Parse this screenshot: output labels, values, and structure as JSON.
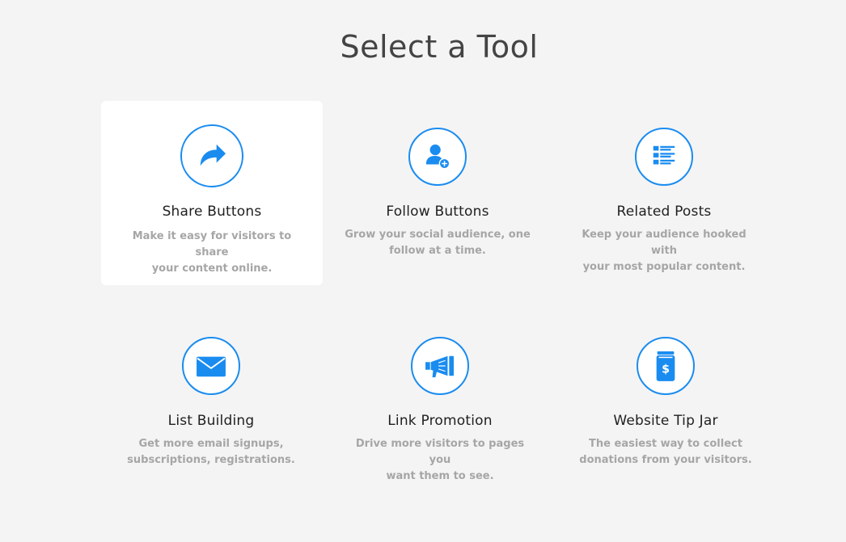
{
  "page": {
    "title": "Select a Tool"
  },
  "colors": {
    "accent": "#1a8cf0",
    "background": "#f4f4f4",
    "title_text": "#444444",
    "card_title_text": "#1f1f1f",
    "description_text": "#a6a6a6",
    "active_card": "#ffffff"
  },
  "tools": [
    {
      "icon": "share-arrow-icon",
      "title": "Share Buttons",
      "desc_line1": "Make it easy for visitors to share",
      "desc_line2": "your content online.",
      "selected": true
    },
    {
      "icon": "add-user-icon",
      "title": "Follow Buttons",
      "desc_line1": "Grow your social audience, one",
      "desc_line2": "follow at a time.",
      "selected": false
    },
    {
      "icon": "list-icon",
      "title": "Related Posts",
      "desc_line1": "Keep your audience hooked with",
      "desc_line2": "your most popular content.",
      "selected": false
    },
    {
      "icon": "envelope-icon",
      "title": "List Building",
      "desc_line1": "Get more email signups,",
      "desc_line2": "subscriptions, registrations.",
      "selected": false
    },
    {
      "icon": "megaphone-icon",
      "title": "Link Promotion",
      "desc_line1": "Drive more visitors to pages you",
      "desc_line2": "want them to see.",
      "selected": false
    },
    {
      "icon": "tip-jar-icon",
      "title": "Website Tip Jar",
      "desc_line1": "The easiest way to collect",
      "desc_line2": "donations from your visitors.",
      "selected": false
    }
  ]
}
